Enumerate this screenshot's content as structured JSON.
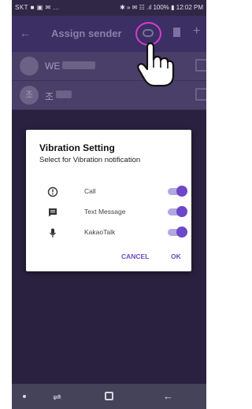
{
  "status": {
    "left": "SKT ■ ▣ ✉ ...",
    "right": "✱ » ✉ ☷ .ıl 100% ▮ 12:02 PM"
  },
  "appbar": {
    "title": "Assign sender"
  },
  "contacts": [
    {
      "initial": "",
      "name": "WE"
    },
    {
      "initial": "조",
      "name": "조"
    }
  ],
  "dialog": {
    "title": "Vibration Setting",
    "subtitle": "Select for Vibration notification",
    "options": [
      {
        "label": "Call",
        "icon": "alert-circle-icon",
        "on": true
      },
      {
        "label": "Text Message",
        "icon": "message-icon",
        "on": true
      },
      {
        "label": "KakaoTalk",
        "icon": "microphone-icon",
        "on": true
      }
    ],
    "cancel": "CANCEL",
    "ok": "OK"
  },
  "colors": {
    "accent": "#6a48c8",
    "highlight_ring": "#d63bd2",
    "appbar": "#3b2f63"
  }
}
